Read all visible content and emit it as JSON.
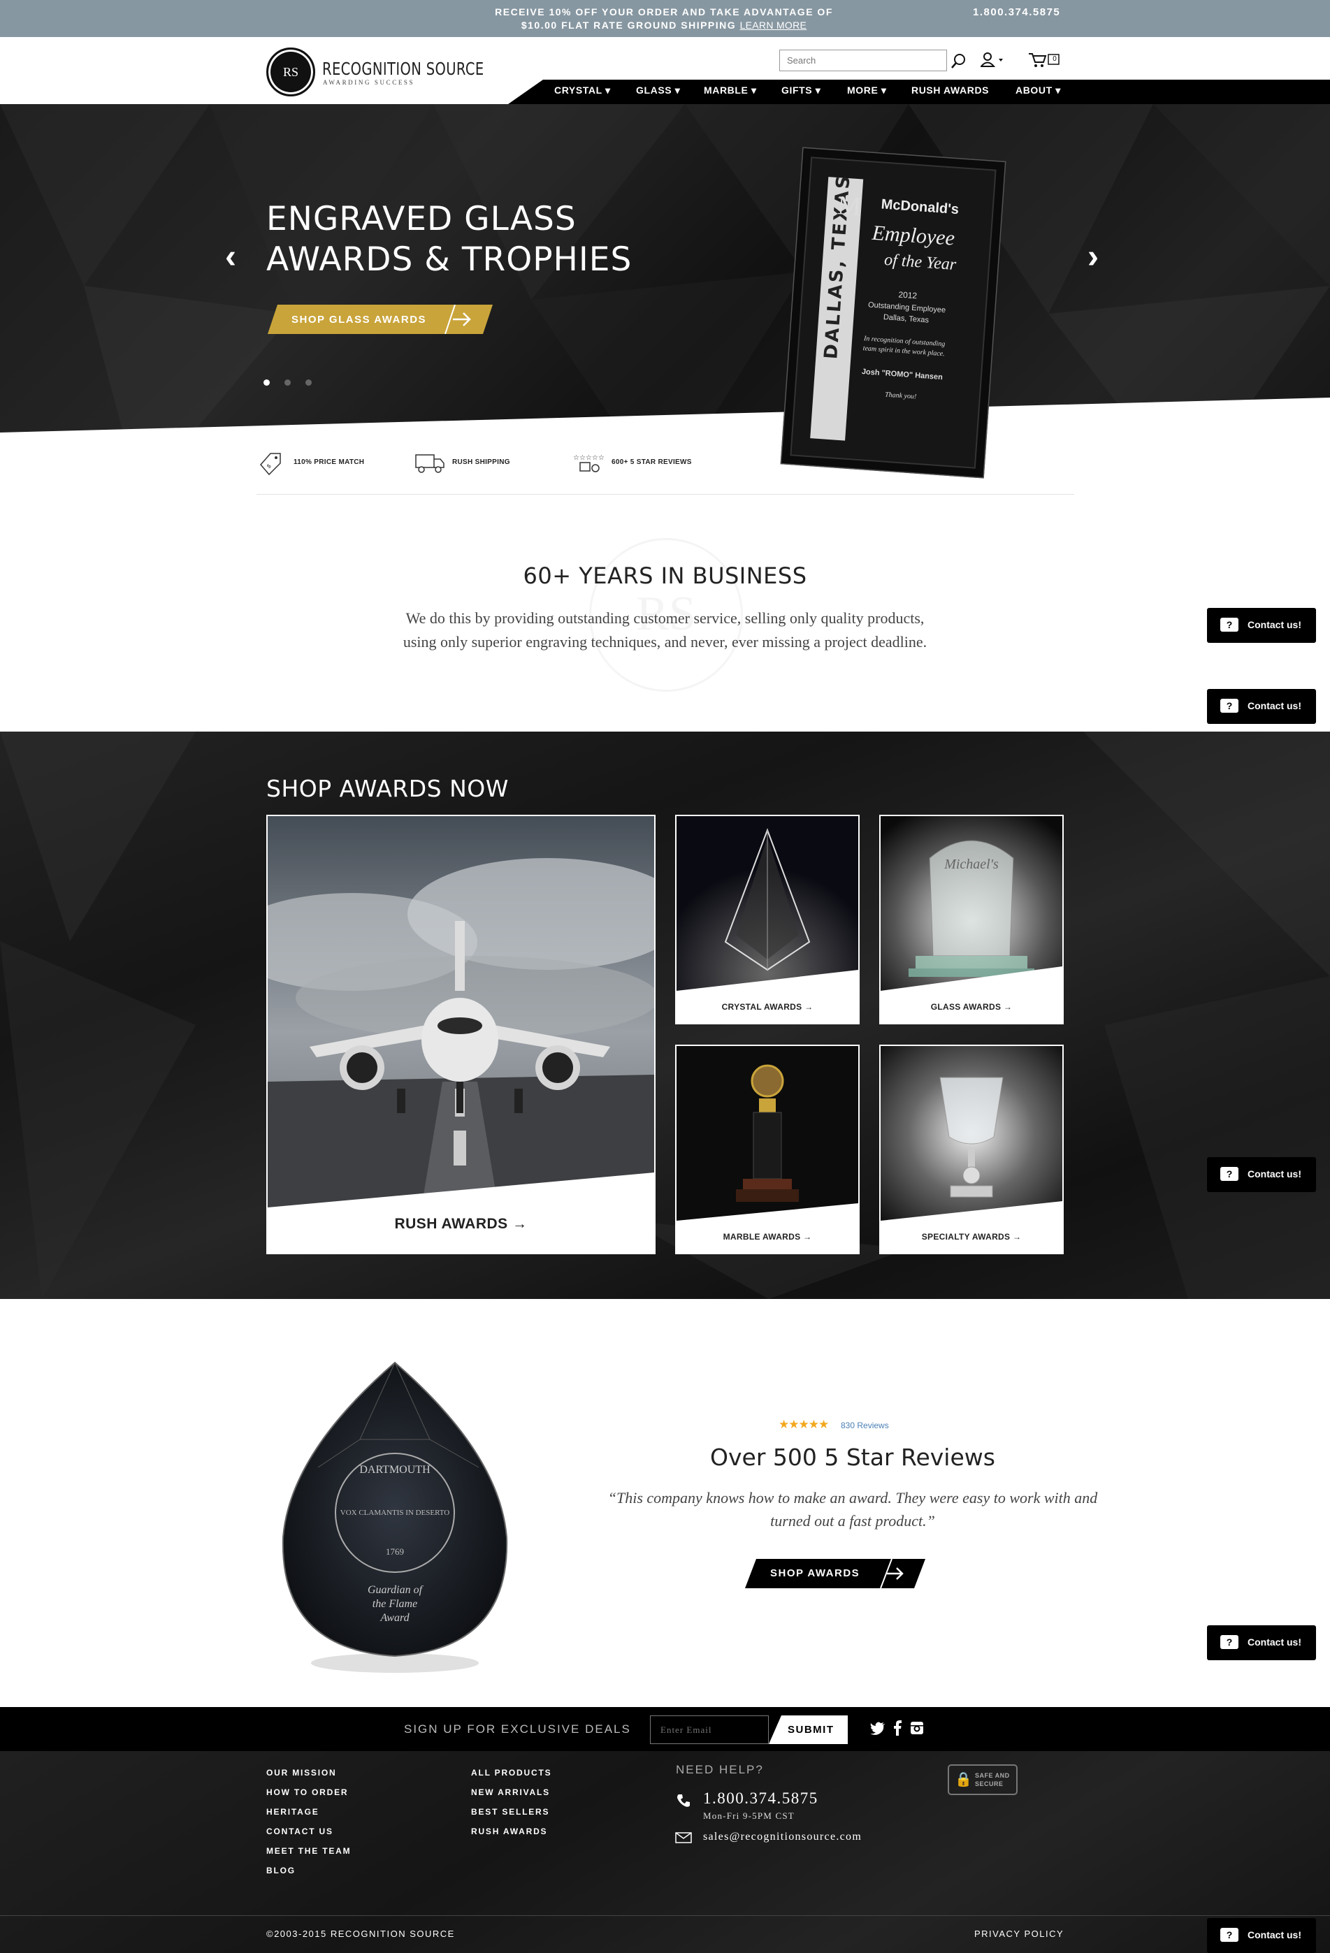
{
  "promo": {
    "line1": "RECEIVE 10% OFF YOUR ORDER AND TAKE ADVANTAGE OF",
    "line2": "$10.00 FLAT RATE GROUND SHIPPING",
    "learn_more": "LEARN MORE",
    "phone": "1.800.374.5875"
  },
  "header": {
    "logo_mark": "RS",
    "logo_name": "RECOGNITION SOURCE",
    "logo_tagline": "AWARDING SUCCESS",
    "search_placeholder": "Search",
    "cart_count": "0"
  },
  "nav": {
    "items": [
      {
        "label": "CRYSTAL",
        "dropdown": true
      },
      {
        "label": "GLASS",
        "dropdown": true
      },
      {
        "label": "MARBLE",
        "dropdown": true
      },
      {
        "label": "GIFTS",
        "dropdown": true
      },
      {
        "label": "MORE",
        "dropdown": true
      },
      {
        "label": "RUSH AWARDS",
        "dropdown": false
      },
      {
        "label": "ABOUT",
        "dropdown": true
      }
    ]
  },
  "hero": {
    "title_line1": "ENGRAVED GLASS",
    "title_line2": "AWARDS & TROPHIES",
    "cta": "SHOP GLASS AWARDS",
    "accent_color": "#c9a43a",
    "slides": 3,
    "active_slide": 1,
    "plaque": {
      "side_text": "DALLAS, TEXAS",
      "brand": "McDonald's",
      "headline1": "Employee",
      "headline2": "of the Year",
      "year": "2012",
      "line1": "Outstanding Employee",
      "line2": "Dallas, Texas",
      "body1": "In recognition of outstanding",
      "body2": "team spirit in the work place.",
      "name": "Josh \"ROMO\" Hansen",
      "closing": "Thank you!"
    }
  },
  "features": [
    {
      "icon": "price-tag-icon",
      "label": "110% PRICE MATCH"
    },
    {
      "icon": "truck-icon",
      "label": "RUSH SHIPPING"
    },
    {
      "icon": "star-reviews-icon",
      "label": "600+ 5 STAR REVIEWS"
    }
  ],
  "about": {
    "title": "60+ YEARS IN BUSINESS",
    "text": "We do this by providing outstanding customer service, selling only quality products, using only superior engraving techniques, and never, ever missing a project deadline.",
    "watermark": "RS"
  },
  "contact_widget": {
    "label": "Contact us!",
    "icon": "?"
  },
  "shop": {
    "title": "SHOP AWARDS NOW",
    "cards": [
      {
        "label": "RUSH AWARDS"
      },
      {
        "label": "CRYSTAL AWARDS"
      },
      {
        "label": "GLASS AWARDS"
      },
      {
        "label": "MARBLE AWARDS"
      },
      {
        "label": "SPECIALTY AWARDS"
      }
    ],
    "glass_engraving": "Michael's"
  },
  "reviews": {
    "stars": "★★★★★",
    "rating": 5,
    "count": "830 Reviews",
    "title": "Over 500 5 Star Reviews",
    "quote": "“This company knows how to make an award. They were easy to work with and turned out a fast product.”",
    "cta": "SHOP AWARDS",
    "award": {
      "top": "DARTMOUTH",
      "motto": "VOX CLAMANTIS IN DESERTO",
      "year": "1769",
      "line1": "Guardian of",
      "line2": "the Flame",
      "line3": "Award"
    }
  },
  "footer": {
    "signup_label": "SIGN UP FOR EXCLUSIVE DEALS",
    "email_placeholder": "Enter Email",
    "submit": "SUBMIT",
    "social": [
      "twitter-icon",
      "facebook-icon",
      "instagram-icon"
    ],
    "col1": [
      "OUR MISSION",
      "HOW TO ORDER",
      "HERITAGE",
      "CONTACT US",
      "MEET THE TEAM",
      "BLOG"
    ],
    "col2": [
      "ALL PRODUCTS",
      "NEW ARRIVALS",
      "BEST SELLERS",
      "RUSH AWARDS"
    ],
    "need_help": "NEED HELP?",
    "phone": "1.800.374.5875",
    "hours": "Mon-Fri 9-5PM CST",
    "email": "sales@recognitionsource.com",
    "safe_line1": "SAFE AND",
    "safe_line2": "SECURE",
    "copyright": "©2003-2015 RECOGNITION SOURCE",
    "privacy": "PRIVACY POLICY"
  }
}
